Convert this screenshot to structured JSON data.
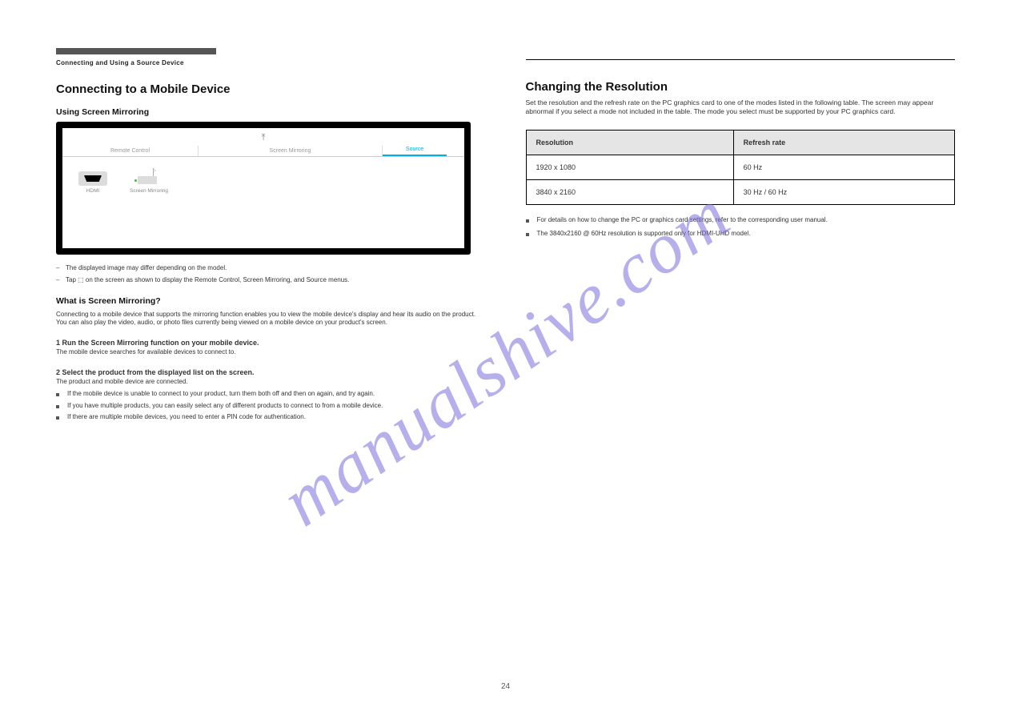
{
  "chapter_label": "Connecting and Using a Source Device",
  "left": {
    "title": "Connecting to a Mobile Device",
    "intro_sub": "Using Screen Mirroring",
    "tabs": {
      "t1": "Remote Control",
      "t2": "Screen Mirroring",
      "t3": "Source"
    },
    "tiles": {
      "hdmi": "HDMI",
      "mirror": "Screen Mirroring"
    },
    "notes": [
      "The displayed image may differ depending on the model.",
      "Tap ⬚ on the screen as shown to display the Remote Control, Screen Mirroring, and Source menus."
    ],
    "what_is_title": "What is Screen Mirroring?",
    "what_is_body": "Connecting to a mobile device that supports the mirroring function enables you to view the mobile device's display and hear its audio on the product. You can also play the video, audio, or photo files currently being viewed on a mobile device on your product's screen.",
    "step1": {
      "title": "1 Run the Screen Mirroring function on your mobile device.",
      "desc": "The mobile device searches for available devices to connect to."
    },
    "step2": {
      "title": "2 Select the product from the displayed list on the screen.",
      "desc": "The product and mobile device are connected."
    },
    "bullets": [
      "If the mobile device is unable to connect to your product, turn them both off and then on again, and try again.",
      "If you have multiple products, you can easily select any of different products to connect to from a mobile device.",
      "If there are multiple mobile devices, you need to enter a PIN code for authentication."
    ]
  },
  "right": {
    "title": "Changing the Resolution",
    "desc": "Set the resolution and the refresh rate on the PC graphics card to one of the modes listed in the following table. The screen may appear abnormal if you select a mode not included in the table. The mode you select must be supported by your PC graphics card.",
    "table": {
      "header": {
        "res": "Resolution",
        "refresh": "Refresh rate"
      },
      "rows": [
        {
          "res": "1920 x 1080",
          "refresh": "60 Hz"
        },
        {
          "res": "3840 x 2160",
          "refresh": "30 Hz / 60 Hz"
        }
      ]
    },
    "bullets": [
      "For details on how to change the PC or graphics card settings, refer to the corresponding user manual.",
      "The 3840x2160 @ 60Hz resolution is supported only for HDMI-UHD model."
    ]
  },
  "watermark": "manualshive.com",
  "page_number": "24"
}
